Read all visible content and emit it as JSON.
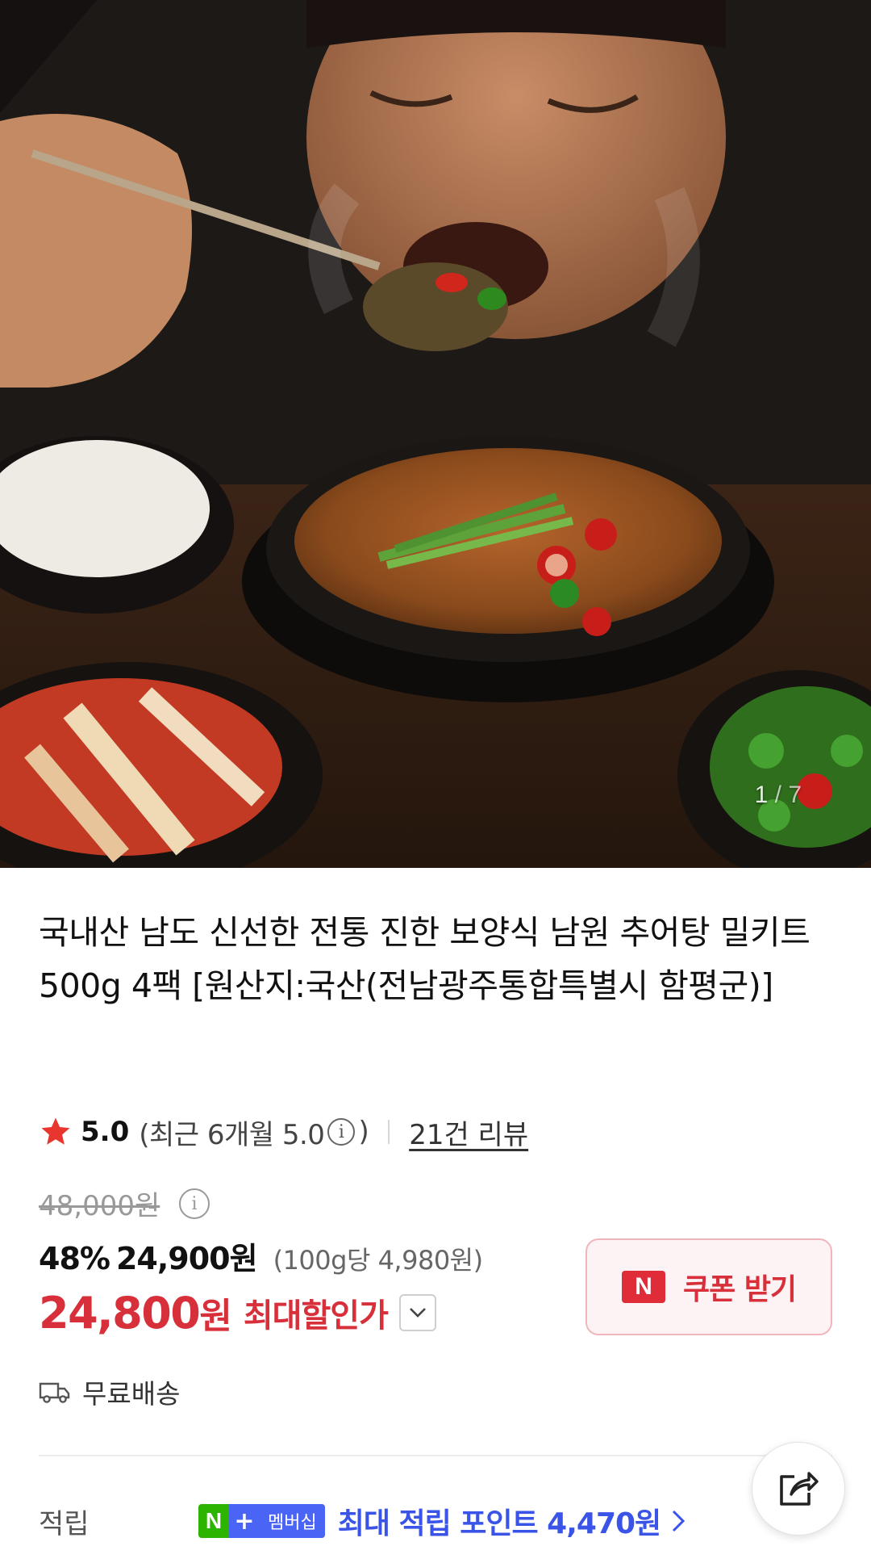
{
  "gallery": {
    "current": "1",
    "separator": "/",
    "total": "7"
  },
  "product": {
    "title": "국내산 남도 신선한 전통 진한 보양식 남원 추어탕 밀키트 500g 4팩 [원산지:국산(전남광주통합특별시 함평군)]"
  },
  "rating": {
    "score": "5.0",
    "recent_prefix": "(최근 6개월 5.0",
    "recent_suffix": ")",
    "info_icon_glyph": "i",
    "review_link": "21건 리뷰",
    "star_color": "#e8362f"
  },
  "price": {
    "original": "48,000원",
    "info_icon_glyph": "i",
    "discount_rate": "48%",
    "sale_price": "24,900원",
    "unit_price": "(100g당 4,980원)",
    "final_amount": "24,800",
    "final_won": "원",
    "max_discount_label": "최대할인가",
    "accent_color": "#d8303a"
  },
  "coupon": {
    "badge": "N",
    "label": "쿠폰 받기"
  },
  "shipping": {
    "icon": "truck-icon",
    "label": "무료배송"
  },
  "points": {
    "label": "적립",
    "badge_n": "N",
    "badge_plus": "+",
    "badge_text": "멤버십",
    "text": "최대 적립 포인트 4,470원",
    "color": "#3a54e8"
  },
  "share": {
    "icon": "share-icon"
  }
}
